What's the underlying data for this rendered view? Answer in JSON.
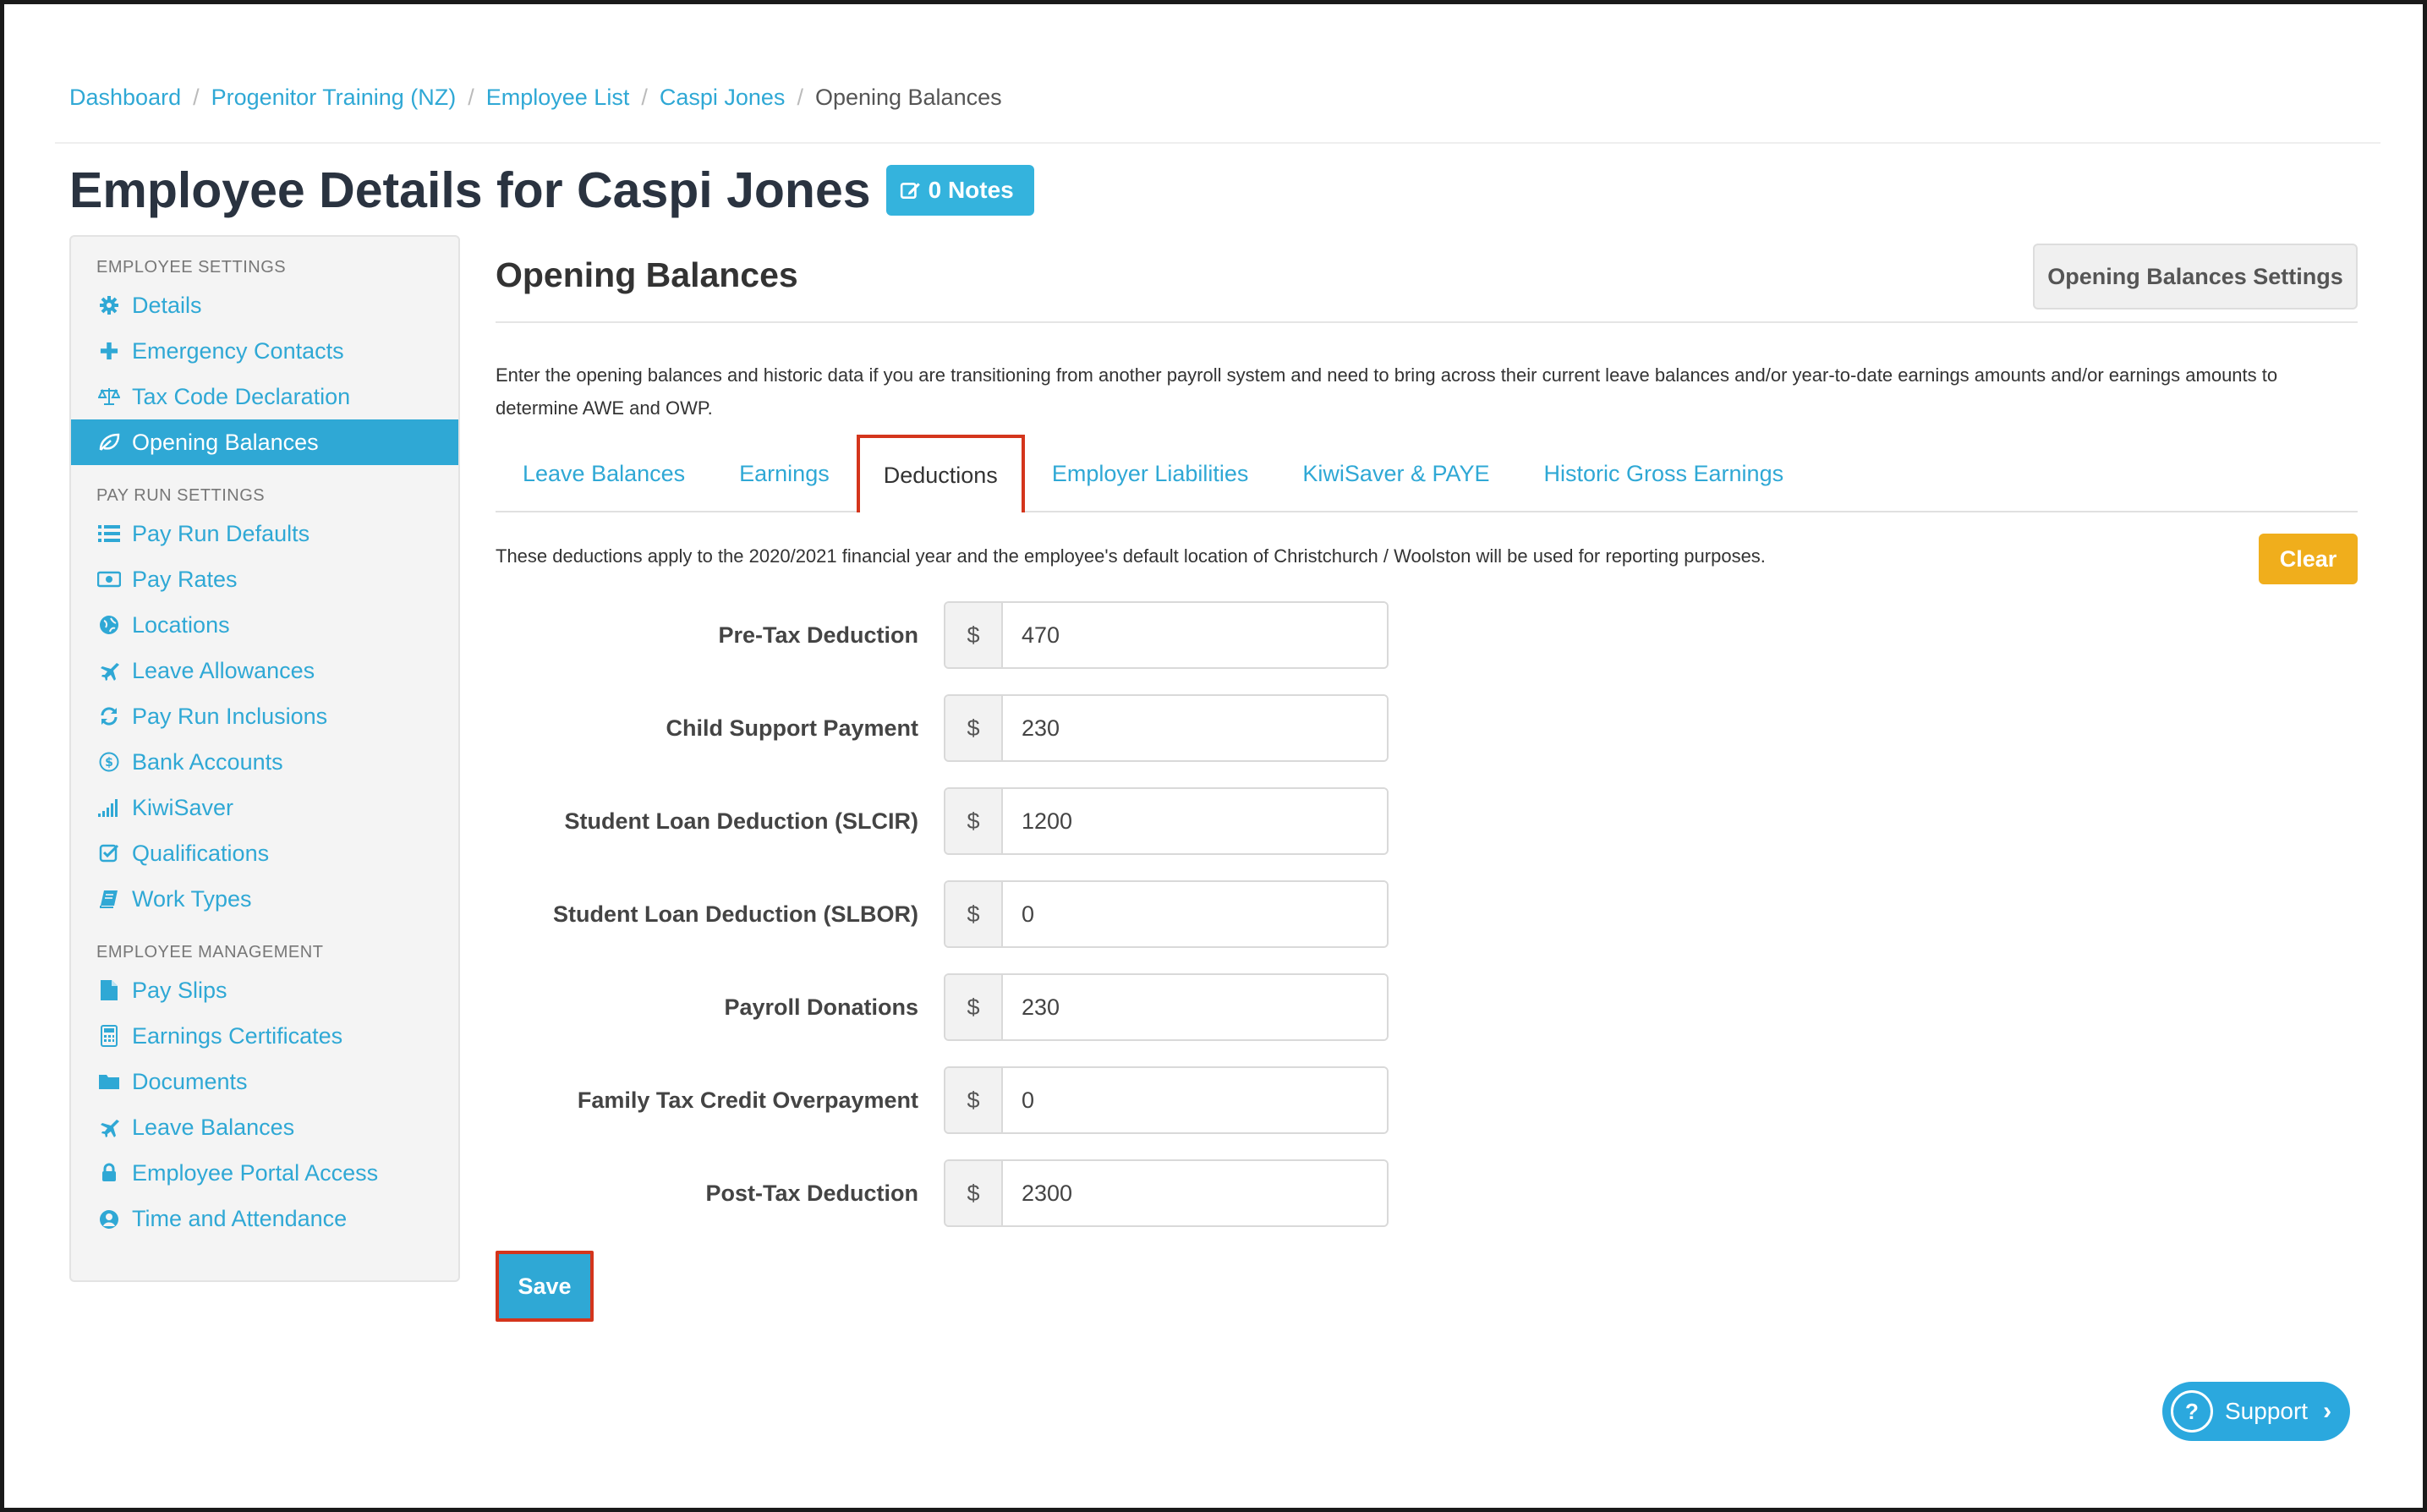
{
  "breadcrumb": {
    "items": [
      "Dashboard",
      "Progenitor Training (NZ)",
      "Employee List",
      "Caspi Jones"
    ],
    "current": "Opening Balances",
    "separator": "/"
  },
  "page": {
    "title": "Employee Details for Caspi Jones",
    "notes_label": "0 Notes"
  },
  "sidebar": {
    "sections": [
      {
        "title": "EMPLOYEE SETTINGS",
        "items": [
          {
            "label": "Details",
            "icon": "gear-icon"
          },
          {
            "label": "Emergency Contacts",
            "icon": "plus-icon"
          },
          {
            "label": "Tax Code Declaration",
            "icon": "scales-icon"
          },
          {
            "label": "Opening Balances",
            "icon": "leaf-icon",
            "active": true
          }
        ]
      },
      {
        "title": "PAY RUN SETTINGS",
        "items": [
          {
            "label": "Pay Run Defaults",
            "icon": "list-icon"
          },
          {
            "label": "Pay Rates",
            "icon": "money-icon"
          },
          {
            "label": "Locations",
            "icon": "globe-icon"
          },
          {
            "label": "Leave Allowances",
            "icon": "plane-icon"
          },
          {
            "label": "Pay Run Inclusions",
            "icon": "refresh-icon"
          },
          {
            "label": "Bank Accounts",
            "icon": "dollar-circle-icon"
          },
          {
            "label": "KiwiSaver",
            "icon": "signal-icon"
          },
          {
            "label": "Qualifications",
            "icon": "checkbox-icon"
          },
          {
            "label": "Work Types",
            "icon": "book-icon"
          }
        ]
      },
      {
        "title": "EMPLOYEE MANAGEMENT",
        "items": [
          {
            "label": "Pay Slips",
            "icon": "file-icon"
          },
          {
            "label": "Earnings Certificates",
            "icon": "calculator-icon"
          },
          {
            "label": "Documents",
            "icon": "folder-icon"
          },
          {
            "label": "Leave Balances",
            "icon": "plane-icon"
          },
          {
            "label": "Employee Portal Access",
            "icon": "lock-icon"
          },
          {
            "label": "Time and Attendance",
            "icon": "user-clock-icon"
          }
        ]
      }
    ]
  },
  "main": {
    "title": "Opening Balances",
    "settings_button": "Opening Balances Settings",
    "intro": "Enter the opening balances and historic data if you are transitioning from another payroll system and need to bring across their current leave balances and/or year-to-date earnings amounts and/or earnings amounts to determine AWE and OWP.",
    "tabs": [
      {
        "label": "Leave Balances"
      },
      {
        "label": "Earnings"
      },
      {
        "label": "Deductions",
        "active": true
      },
      {
        "label": "Employer Liabilities"
      },
      {
        "label": "KiwiSaver & PAYE"
      },
      {
        "label": "Historic Gross Earnings"
      }
    ],
    "notice": "These deductions apply to the 2020/2021 financial year and the employee's default location of Christchurch / Woolston will be used for reporting purposes.",
    "clear_button": "Clear",
    "currency_symbol": "$",
    "fields": [
      {
        "label": "Pre-Tax Deduction",
        "value": "470"
      },
      {
        "label": "Child Support Payment",
        "value": "230"
      },
      {
        "label": "Student Loan Deduction (SLCIR)",
        "value": "1200"
      },
      {
        "label": "Student Loan Deduction (SLBOR)",
        "value": "0"
      },
      {
        "label": "Payroll Donations",
        "value": "230"
      },
      {
        "label": "Family Tax Credit Overpayment",
        "value": "0"
      },
      {
        "label": "Post-Tax Deduction",
        "value": "2300"
      }
    ],
    "save_button": "Save"
  },
  "support": {
    "label": "Support"
  },
  "colors": {
    "accent": "#2fa8d5",
    "highlight": "#d4351c",
    "clear": "#f0ae1c"
  }
}
